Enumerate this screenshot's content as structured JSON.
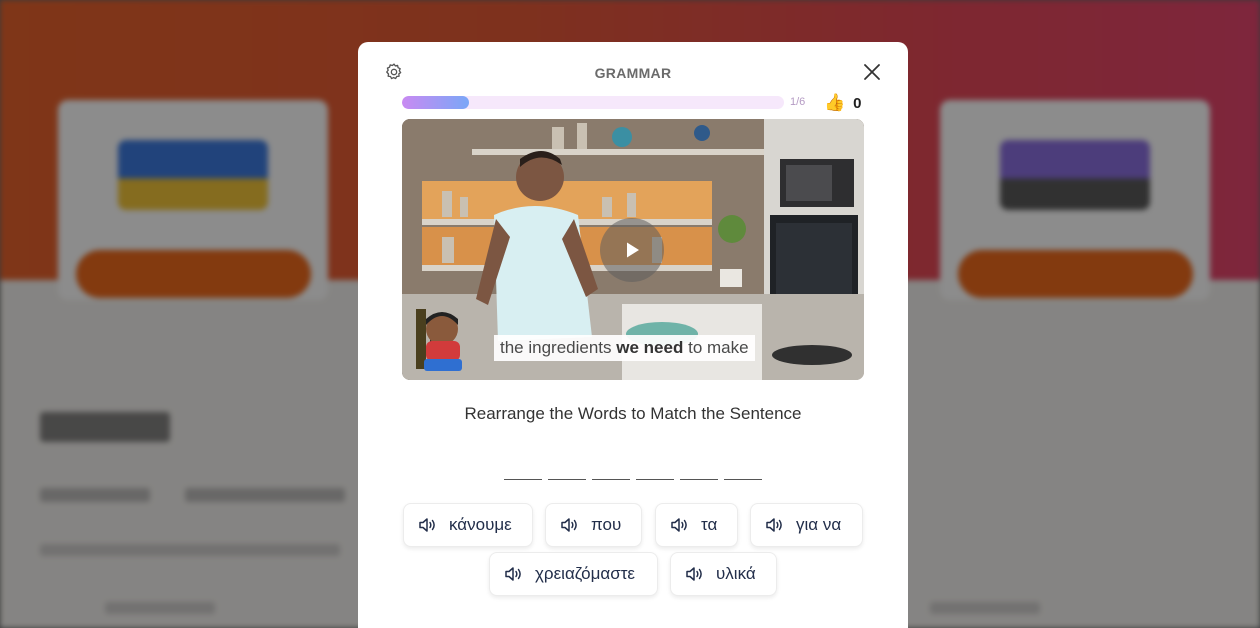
{
  "modal": {
    "title": "GRAMMAR",
    "progress": {
      "label": "1/6",
      "fraction": 0.176
    },
    "likes": "0"
  },
  "video": {
    "subtitle_before": "the ingredients",
    "subtitle_bold": "we need",
    "subtitle_after": "to make"
  },
  "exercise": {
    "instruction": "Rearrange the Words to Match the Sentence",
    "blank_count": 6,
    "words": [
      "κάνουμε",
      "που",
      "τα",
      "για να",
      "χρειαζόμαστε",
      "υλικά"
    ]
  },
  "icons": {
    "settings": "gear-icon",
    "close": "close-icon",
    "play": "play-icon",
    "like": "thumbs-up-icon",
    "audio": "speaker-icon"
  },
  "colors": {
    "progress_start": "#c98af2",
    "progress_end": "#7aa7f7",
    "word_text": "#222e4a",
    "background_orange": "#e8632c",
    "background_pink": "#e5456e"
  }
}
